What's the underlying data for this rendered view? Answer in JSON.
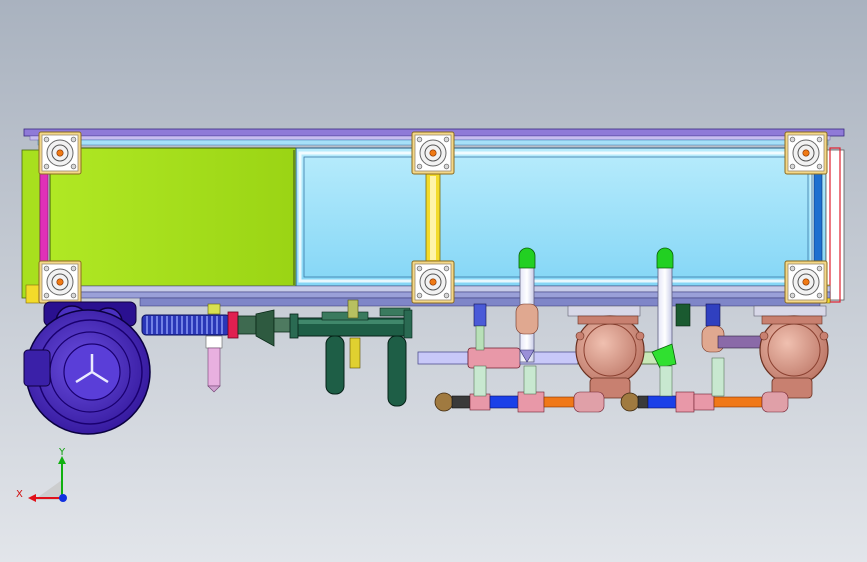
{
  "view": {
    "background_top": "#a9b2bf",
    "background_bottom": "#e2e5ea"
  },
  "triad": {
    "x_label": "X",
    "y_label": "Y",
    "x_color": "#e0101a",
    "y_color": "#10b010",
    "z_color": "#1030e0"
  },
  "colors": {
    "frame_top": "#8a77d8",
    "panel_green": "#a8e01e",
    "panel_blue": "#98e0fb",
    "bracket_yellow": "#f3db2a",
    "bracket_magenta": "#e020b0",
    "bracket_blue": "#1e6fd0",
    "blower": "#3a1aa8",
    "copper": "#d9a090",
    "pipe_green": "#1e5e46",
    "pipe_pink": "#e8a0b0",
    "pipe_orange": "#f07818",
    "pipe_blue": "#1a40e8",
    "valve_green": "#1ec81e"
  },
  "icons": [
    "bearing-flange-icon",
    "blower-icon",
    "pump-icon",
    "coordinate-triad-icon"
  ]
}
